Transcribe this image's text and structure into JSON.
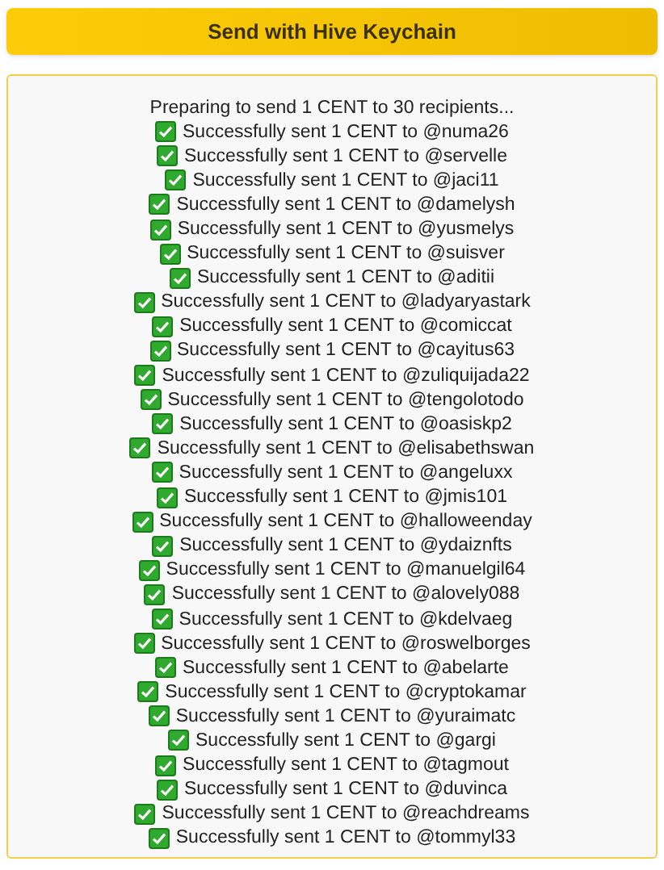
{
  "button": {
    "label": "Send with Hive Keychain"
  },
  "log": [
    {
      "kind": "info",
      "text": "Preparing to send 1 CENT to 30 recipients..."
    },
    {
      "kind": "success",
      "text": "Successfully sent 1 CENT to @numa26"
    },
    {
      "kind": "success",
      "text": "Successfully sent 1 CENT to @servelle"
    },
    {
      "kind": "success",
      "text": "Successfully sent 1 CENT to @jaci11"
    },
    {
      "kind": "success",
      "text": "Successfully sent 1 CENT to @damelysh"
    },
    {
      "kind": "success",
      "text": "Successfully sent 1 CENT to @yusmelys"
    },
    {
      "kind": "success",
      "text": "Successfully sent 1 CENT to @suisver"
    },
    {
      "kind": "success",
      "text": "Successfully sent 1 CENT to @aditii"
    },
    {
      "kind": "success",
      "text": "Successfully sent 1 CENT to @ladyaryastark"
    },
    {
      "kind": "success",
      "text": "Successfully sent 1 CENT to @comiccat"
    },
    {
      "kind": "success",
      "text": "Successfully sent 1 CENT to @cayitus63"
    },
    {
      "kind": "success",
      "text": "Successfully sent 1 CENT to @zuliquijada22"
    },
    {
      "kind": "success",
      "text": "Successfully sent 1 CENT to @tengolotodo"
    },
    {
      "kind": "success",
      "text": "Successfully sent 1 CENT to @oasiskp2"
    },
    {
      "kind": "success",
      "text": "Successfully sent 1 CENT to @elisabethswan"
    },
    {
      "kind": "success",
      "text": "Successfully sent 1 CENT to @angeluxx"
    },
    {
      "kind": "success",
      "text": "Successfully sent 1 CENT to @jmis101"
    },
    {
      "kind": "success",
      "text": "Successfully sent 1 CENT to @halloweenday"
    },
    {
      "kind": "success",
      "text": "Successfully sent 1 CENT to @ydaiznfts"
    },
    {
      "kind": "success",
      "text": "Successfully sent 1 CENT to @manuelgil64"
    },
    {
      "kind": "success",
      "text": "Successfully sent 1 CENT to @alovely088"
    },
    {
      "kind": "success",
      "text": "Successfully sent 1 CENT to @kdelvaeg"
    },
    {
      "kind": "success",
      "text": "Successfully sent 1 CENT to @roswelborges"
    },
    {
      "kind": "success",
      "text": "Successfully sent 1 CENT to @abelarte"
    },
    {
      "kind": "success",
      "text": "Successfully sent 1 CENT to @cryptokamar"
    },
    {
      "kind": "success",
      "text": "Successfully sent 1 CENT to @yuraimatc"
    },
    {
      "kind": "success",
      "text": "Successfully sent 1 CENT to @gargi"
    },
    {
      "kind": "success",
      "text": "Successfully sent 1 CENT to @tagmout"
    },
    {
      "kind": "success",
      "text": "Successfully sent 1 CENT to @duvinca"
    },
    {
      "kind": "success",
      "text": "Successfully sent 1 CENT to @reachdreams"
    },
    {
      "kind": "success",
      "text": "Successfully sent 1 CENT to @tommyl33"
    }
  ]
}
